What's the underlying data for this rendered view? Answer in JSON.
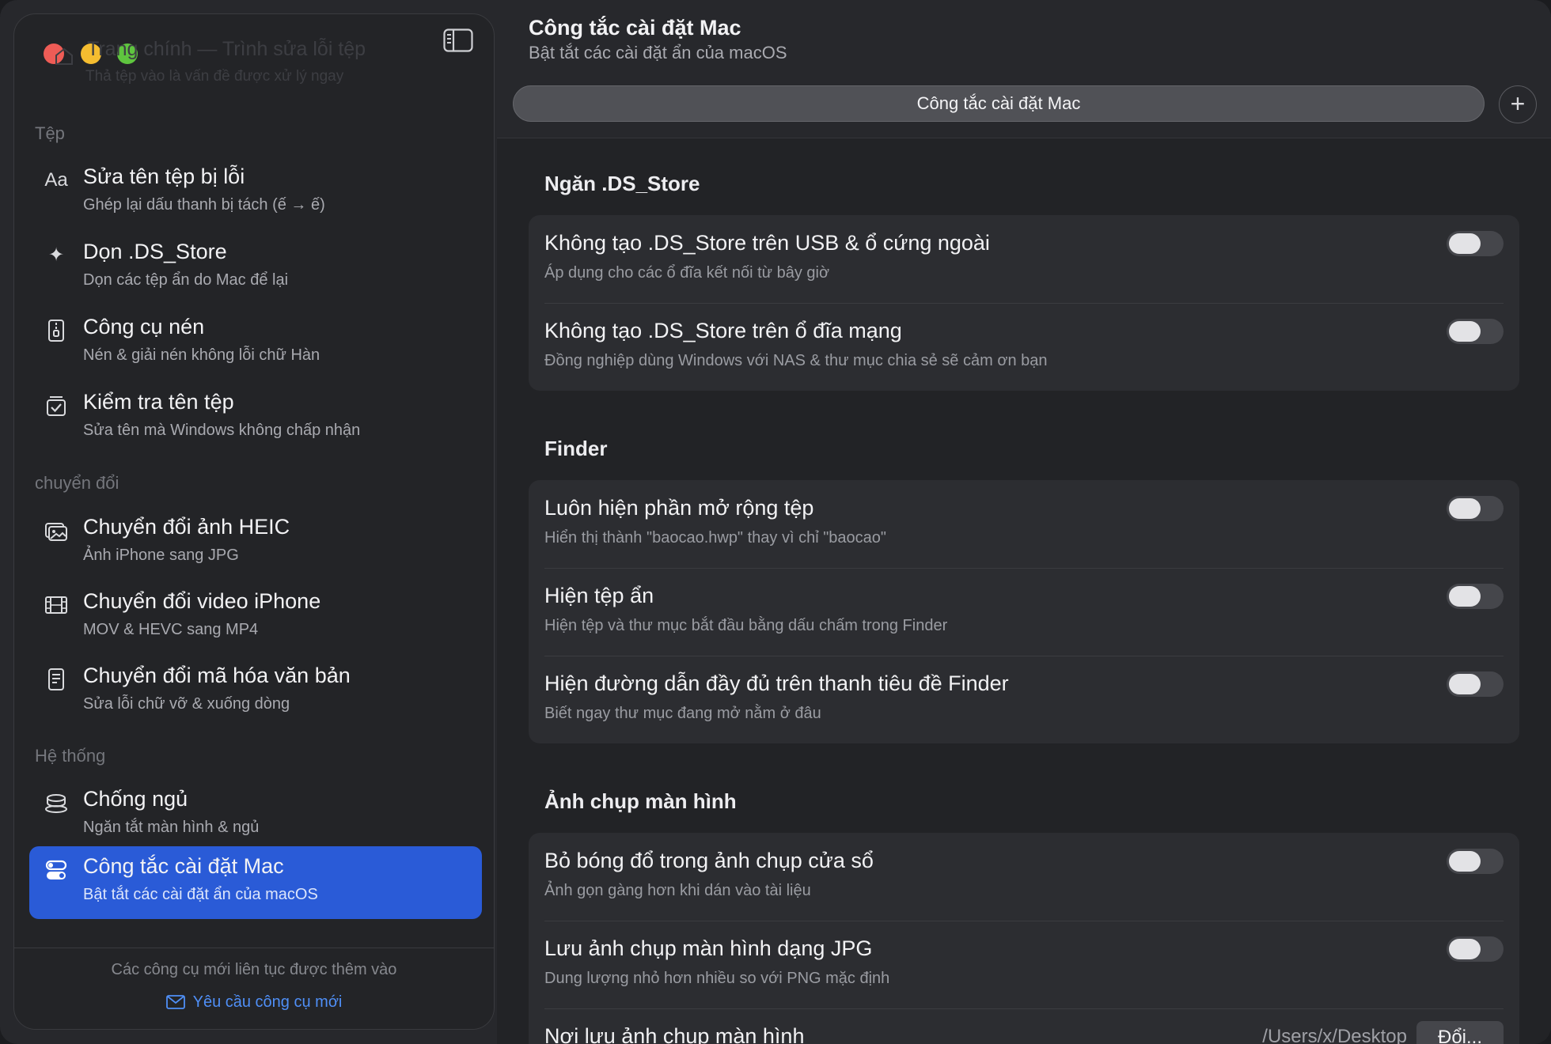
{
  "sidebar": {
    "ghost_title": "Trang chính — Trình sửa lỗi tệp",
    "ghost_subtitle": "Thả tệp vào là vấn đề được xử lý ngay",
    "sections": {
      "files": "Tệp",
      "convert": "chuyển đổi",
      "system": "Hệ thống"
    },
    "items": [
      {
        "title": "Sửa tên tệp bị lỗi",
        "subtitle": "Ghép lại dấu thanh bị tách (ế → ế)",
        "icon": "text-format-icon",
        "glyph": "Aa"
      },
      {
        "title": "Dọn .DS_Store",
        "subtitle": "Dọn các tệp ẩn do Mac để lại",
        "icon": "sparkle-icon",
        "glyph": "✦"
      },
      {
        "title": "Công cụ nén",
        "subtitle": "Nén & giải nén không lỗi chữ Hàn",
        "icon": "zip-file-icon",
        "glyph": ""
      },
      {
        "title": "Kiểm tra tên tệp",
        "subtitle": "Sửa tên mà Windows không chấp nhận",
        "icon": "checklist-icon",
        "glyph": ""
      },
      {
        "title": "Chuyển đổi ảnh HEIC",
        "subtitle": "Ảnh iPhone sang JPG",
        "icon": "photos-icon",
        "glyph": ""
      },
      {
        "title": "Chuyển đổi video iPhone",
        "subtitle": "MOV & HEVC sang MP4",
        "icon": "film-icon",
        "glyph": ""
      },
      {
        "title": "Chuyển đổi mã hóa văn bản",
        "subtitle": "Sửa lỗi chữ vỡ & xuống dòng",
        "icon": "document-icon",
        "glyph": ""
      },
      {
        "title": "Chống ngủ",
        "subtitle": "Ngăn tắt màn hình & ngủ",
        "icon": "coffee-cup-icon",
        "glyph": ""
      },
      {
        "title": "Công tắc cài đặt Mac",
        "subtitle": "Bật tắt các cài đặt ẩn của macOS",
        "icon": "switches-icon",
        "glyph": ""
      }
    ],
    "footer_note": "Các công cụ mới liên tục được thêm vào",
    "footer_link": "Yêu cầu công cụ mới"
  },
  "main": {
    "title": "Công tắc cài đặt Mac",
    "subtitle": "Bật tắt các cài đặt ẩn của macOS",
    "tab_label": "Công tắc cài đặt Mac",
    "add_label": "+",
    "groups": [
      {
        "title": "Ngăn .DS_Store",
        "rows": [
          {
            "title": "Không tạo .DS_Store trên USB & ổ cứng ngoài",
            "subtitle": "Áp dụng cho các ổ đĩa kết nối từ bây giờ",
            "on": false
          },
          {
            "title": "Không tạo .DS_Store trên ổ đĩa mạng",
            "subtitle": "Đồng nghiệp dùng Windows với NAS & thư mục chia sẻ sẽ cảm ơn bạn",
            "on": false
          }
        ]
      },
      {
        "title": "Finder",
        "rows": [
          {
            "title": "Luôn hiện phần mở rộng tệp",
            "subtitle": "Hiển thị thành \"baocao.hwp\" thay vì chỉ \"baocao\"",
            "on": false
          },
          {
            "title": "Hiện tệp ẩn",
            "subtitle": "Hiện tệp và thư mục bắt đầu bằng dấu chấm trong Finder",
            "on": false
          },
          {
            "title": "Hiện đường dẫn đầy đủ trên thanh tiêu đề Finder",
            "subtitle": "Biết ngay thư mục đang mở nằm ở đâu",
            "on": false
          }
        ]
      },
      {
        "title": "Ảnh chụp màn hình",
        "rows": [
          {
            "title": "Bỏ bóng đổ trong ảnh chụp cửa sổ",
            "subtitle": "Ảnh gọn gàng hơn khi dán vào tài liệu",
            "on": false
          },
          {
            "title": "Lưu ảnh chụp màn hình dạng JPG",
            "subtitle": "Dung lượng nhỏ hơn nhiều so với PNG mặc định",
            "on": false
          },
          {
            "title": "Nơi lưu ảnh chụp màn hình",
            "path": "/Users/x/Desktop",
            "button": "Đổi..."
          }
        ]
      }
    ]
  },
  "colors": {
    "accent": "#2a5bd7",
    "link": "#4f8ff7",
    "traffic_red": "#ee5c56",
    "traffic_yellow": "#f5bd30",
    "traffic_green": "#5fc53f"
  }
}
